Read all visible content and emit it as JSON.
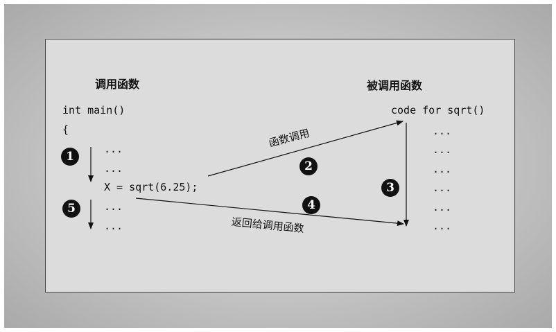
{
  "caller_title": "调用函数",
  "callee_title": "被调用函数",
  "caller_code": {
    "line1": "int main()",
    "line2": "{",
    "line3": "...",
    "line4": "...",
    "line5": "X = sqrt(6.25);",
    "line6": "...",
    "line7": "..."
  },
  "callee_code": {
    "header": "code for sqrt()",
    "dots": [
      "...",
      "...",
      "...",
      "...",
      "...",
      "..."
    ]
  },
  "arrow_labels": {
    "call": "函数调用",
    "return": "返回给调用函数"
  },
  "steps": [
    "1",
    "2",
    "3",
    "4",
    "5"
  ]
}
